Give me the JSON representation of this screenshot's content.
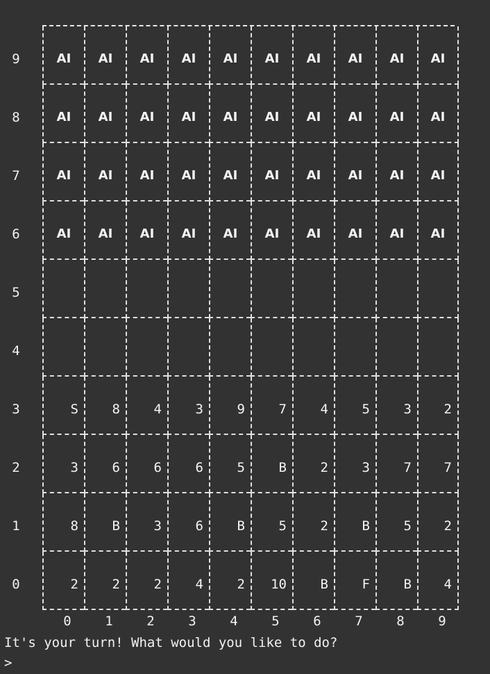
{
  "board": {
    "row_labels": [
      "9",
      "8",
      "7",
      "6",
      "5",
      "4",
      "3",
      "2",
      "1",
      "0"
    ],
    "col_labels": [
      "0",
      "1",
      "2",
      "3",
      "4",
      "5",
      "6",
      "7",
      "8",
      "9"
    ],
    "rows": [
      [
        "AI",
        "AI",
        "AI",
        "AI",
        "AI",
        "AI",
        "AI",
        "AI",
        "AI",
        "AI"
      ],
      [
        "AI",
        "AI",
        "AI",
        "AI",
        "AI",
        "AI",
        "AI",
        "AI",
        "AI",
        "AI"
      ],
      [
        "AI",
        "AI",
        "AI",
        "AI",
        "AI",
        "AI",
        "AI",
        "AI",
        "AI",
        "AI"
      ],
      [
        "AI",
        "AI",
        "AI",
        "AI",
        "AI",
        "AI",
        "AI",
        "AI",
        "AI",
        "AI"
      ],
      [
        "",
        "",
        "",
        "",
        "",
        "",
        "",
        "",
        "",
        ""
      ],
      [
        "",
        "",
        "",
        "",
        "",
        "",
        "",
        "",
        "",
        ""
      ],
      [
        "S",
        "8",
        "4",
        "3",
        "9",
        "7",
        "4",
        "5",
        "3",
        "2"
      ],
      [
        "3",
        "6",
        "6",
        "6",
        "5",
        "B",
        "2",
        "3",
        "7",
        "7"
      ],
      [
        "8",
        "B",
        "3",
        "6",
        "B",
        "5",
        "2",
        "B",
        "5",
        "2"
      ],
      [
        "2",
        "2",
        "2",
        "4",
        "2",
        "10",
        "B",
        "F",
        "B",
        "4"
      ]
    ]
  },
  "console": {
    "prompt_message": "It's your turn! What would you like to do?",
    "input_prompt": ">"
  }
}
